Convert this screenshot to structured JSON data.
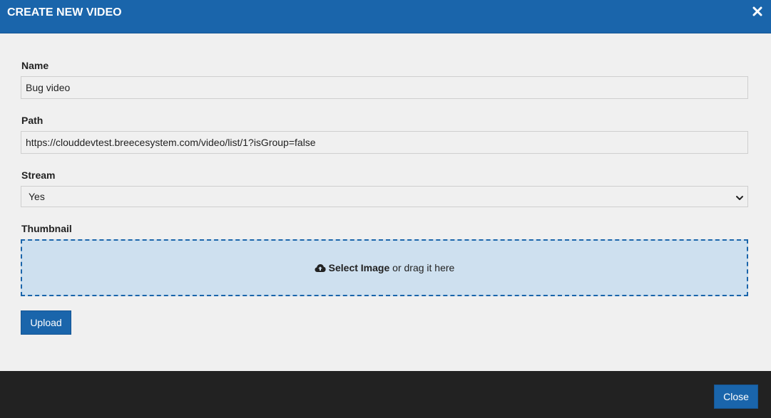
{
  "dialog": {
    "title": "CREATE NEW VIDEO",
    "close_icon": "close-icon"
  },
  "form": {
    "name": {
      "label": "Name",
      "value": "Bug video"
    },
    "path": {
      "label": "Path",
      "value": "https://clouddevtest.breecesystem.com/video/list/1?isGroup=false"
    },
    "stream": {
      "label": "Stream",
      "selected": "Yes"
    },
    "thumbnail": {
      "label": "Thumbnail",
      "icon": "cloud-upload-icon",
      "select_text": "Select Image",
      "drag_text": " or drag it here"
    },
    "upload_label": "Upload"
  },
  "footer": {
    "close_label": "Close"
  },
  "colors": {
    "header": "#1a65ab",
    "body": "#f0f0f0",
    "dropzone": "#cee0ef",
    "footer": "#222222"
  }
}
